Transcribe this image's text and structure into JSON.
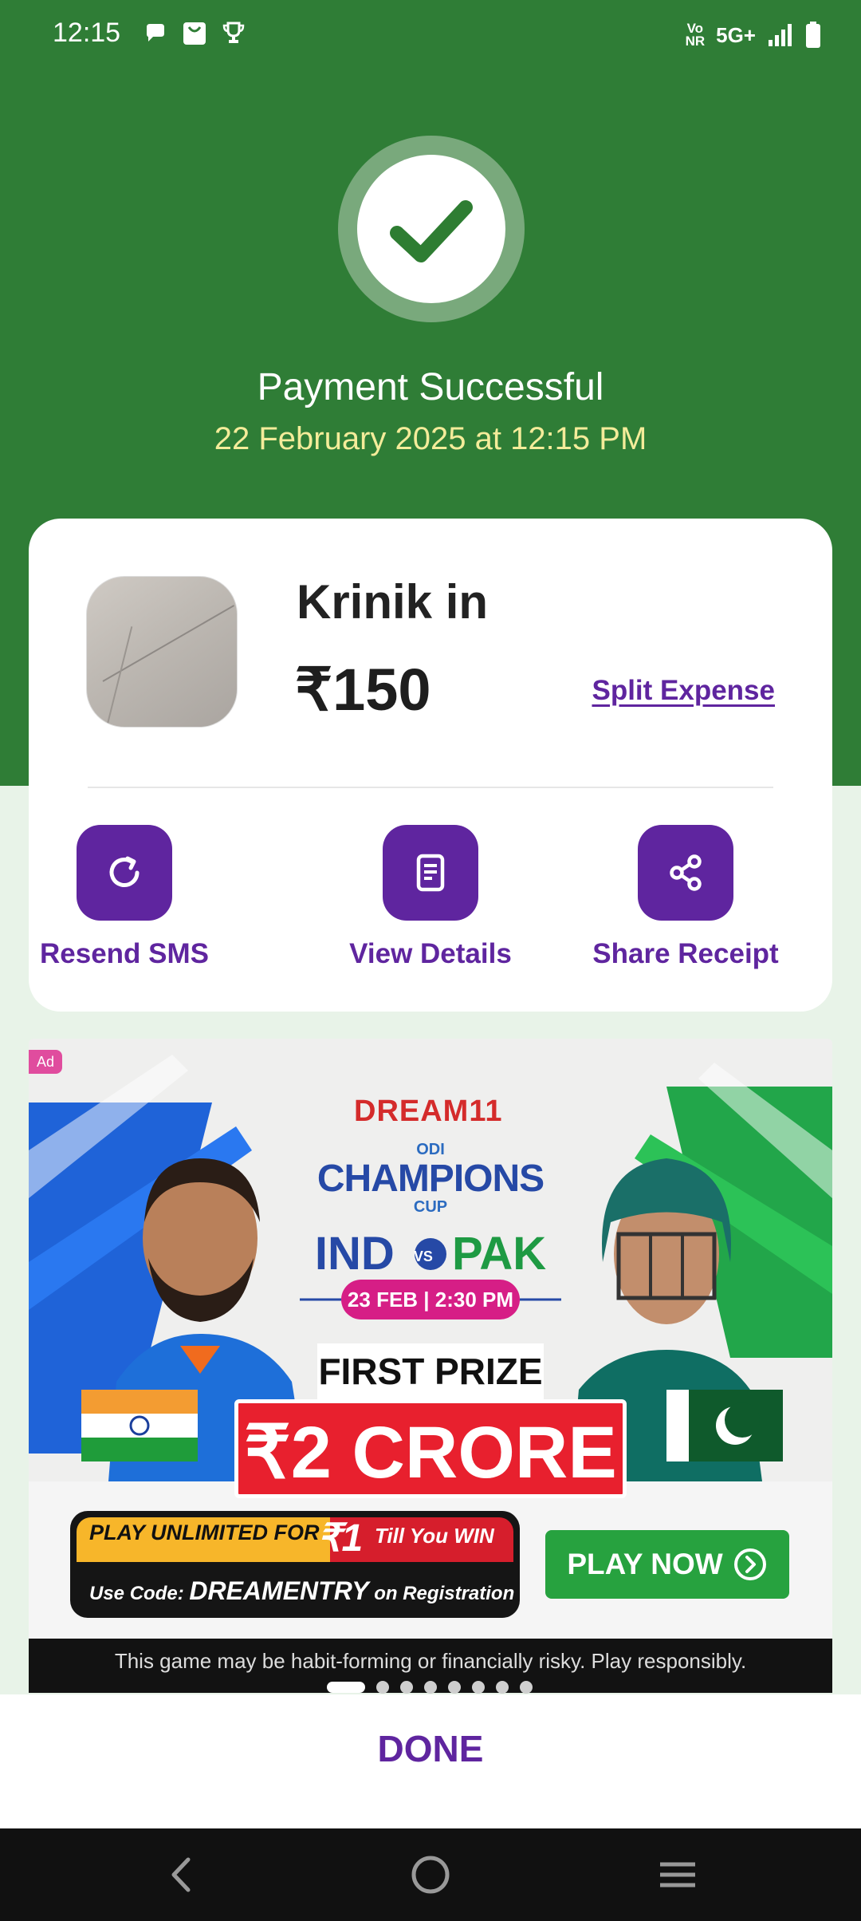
{
  "status_bar": {
    "time": "12:15",
    "volte_line1": "Vo",
    "volte_line2": "NR",
    "network": "5G+",
    "notification_icons": [
      "chat-icon",
      "shopping-bag-icon",
      "trophy-icon"
    ]
  },
  "payment": {
    "title": "Payment Successful",
    "datetime": "22 February 2025 at 12:15 PM"
  },
  "merchant": {
    "name": "Krinik in",
    "amount": "₹150",
    "split_label": "Split Expense"
  },
  "actions": [
    {
      "label": "Resend SMS",
      "icon": "refresh-icon"
    },
    {
      "label": "View Details",
      "icon": "document-icon"
    },
    {
      "label": "Share Receipt",
      "icon": "share-icon"
    }
  ],
  "ad": {
    "tag": "Ad",
    "brand": "DREAM11",
    "tournament_top": "ODI",
    "tournament_main": "CHAMPIONS",
    "tournament_bottom": "CUP",
    "team1": "IND",
    "vs": "VS",
    "team2": "PAK",
    "match_date": "23 FEB | 2:30 PM",
    "first_prize_label": "FIRST PRIZE",
    "prize_amount": "₹2 CRORE",
    "offer_text": "PLAY UNLIMITED FOR",
    "offer_price": "₹1",
    "offer_suffix": "Till You WIN",
    "code_prefix": "Use Code:",
    "code": "DREAMENTRY",
    "code_suffix": "on Registration",
    "cta": "PLAY NOW",
    "disclaimer": "This game may be habit-forming or financially risky. Play responsibly.",
    "slides_total": 8,
    "slide_active": 1
  },
  "done_label": "DONE",
  "nav": {
    "back": "back-icon",
    "home": "home-icon",
    "menu": "menu-icon"
  },
  "colors": {
    "header_green": "#2f7d36",
    "accent_purple": "#5f259f",
    "date_yellow": "#f4ec9a"
  }
}
